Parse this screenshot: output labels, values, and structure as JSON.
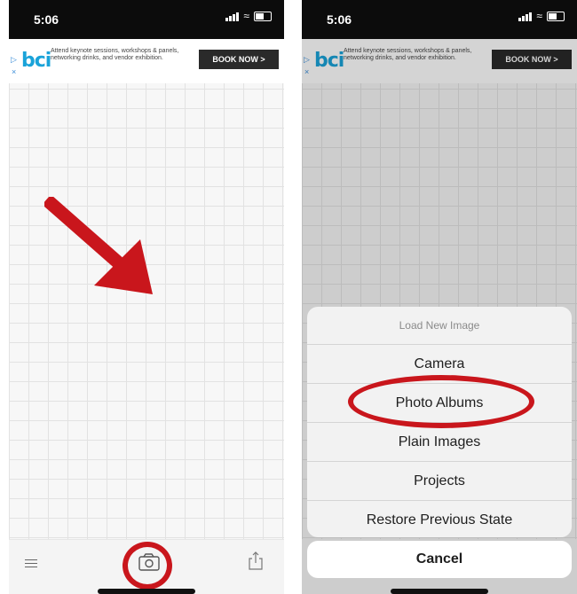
{
  "status_bar": {
    "time": "5:06"
  },
  "ad": {
    "logo": "bci",
    "text": "Attend keynote sessions, workshops & panels, networking drinks, and vendor exhibition.",
    "button_label": "BOOK NOW >",
    "play_icon": "▷",
    "close_icon": "×"
  },
  "action_sheet": {
    "title": "Load New Image",
    "items": [
      "Camera",
      "Photo Albums",
      "Plain Images",
      "Projects",
      "Restore Previous State"
    ],
    "cancel_label": "Cancel",
    "highlighted_item": "Photo Albums"
  },
  "toolbar": {
    "icons": [
      "menu-icon",
      "camera-icon",
      "share-icon"
    ]
  },
  "colors": {
    "annotation": "#c9161c",
    "ad_logo": "#1aa3d9",
    "ad_button": "#2a2a2a"
  }
}
